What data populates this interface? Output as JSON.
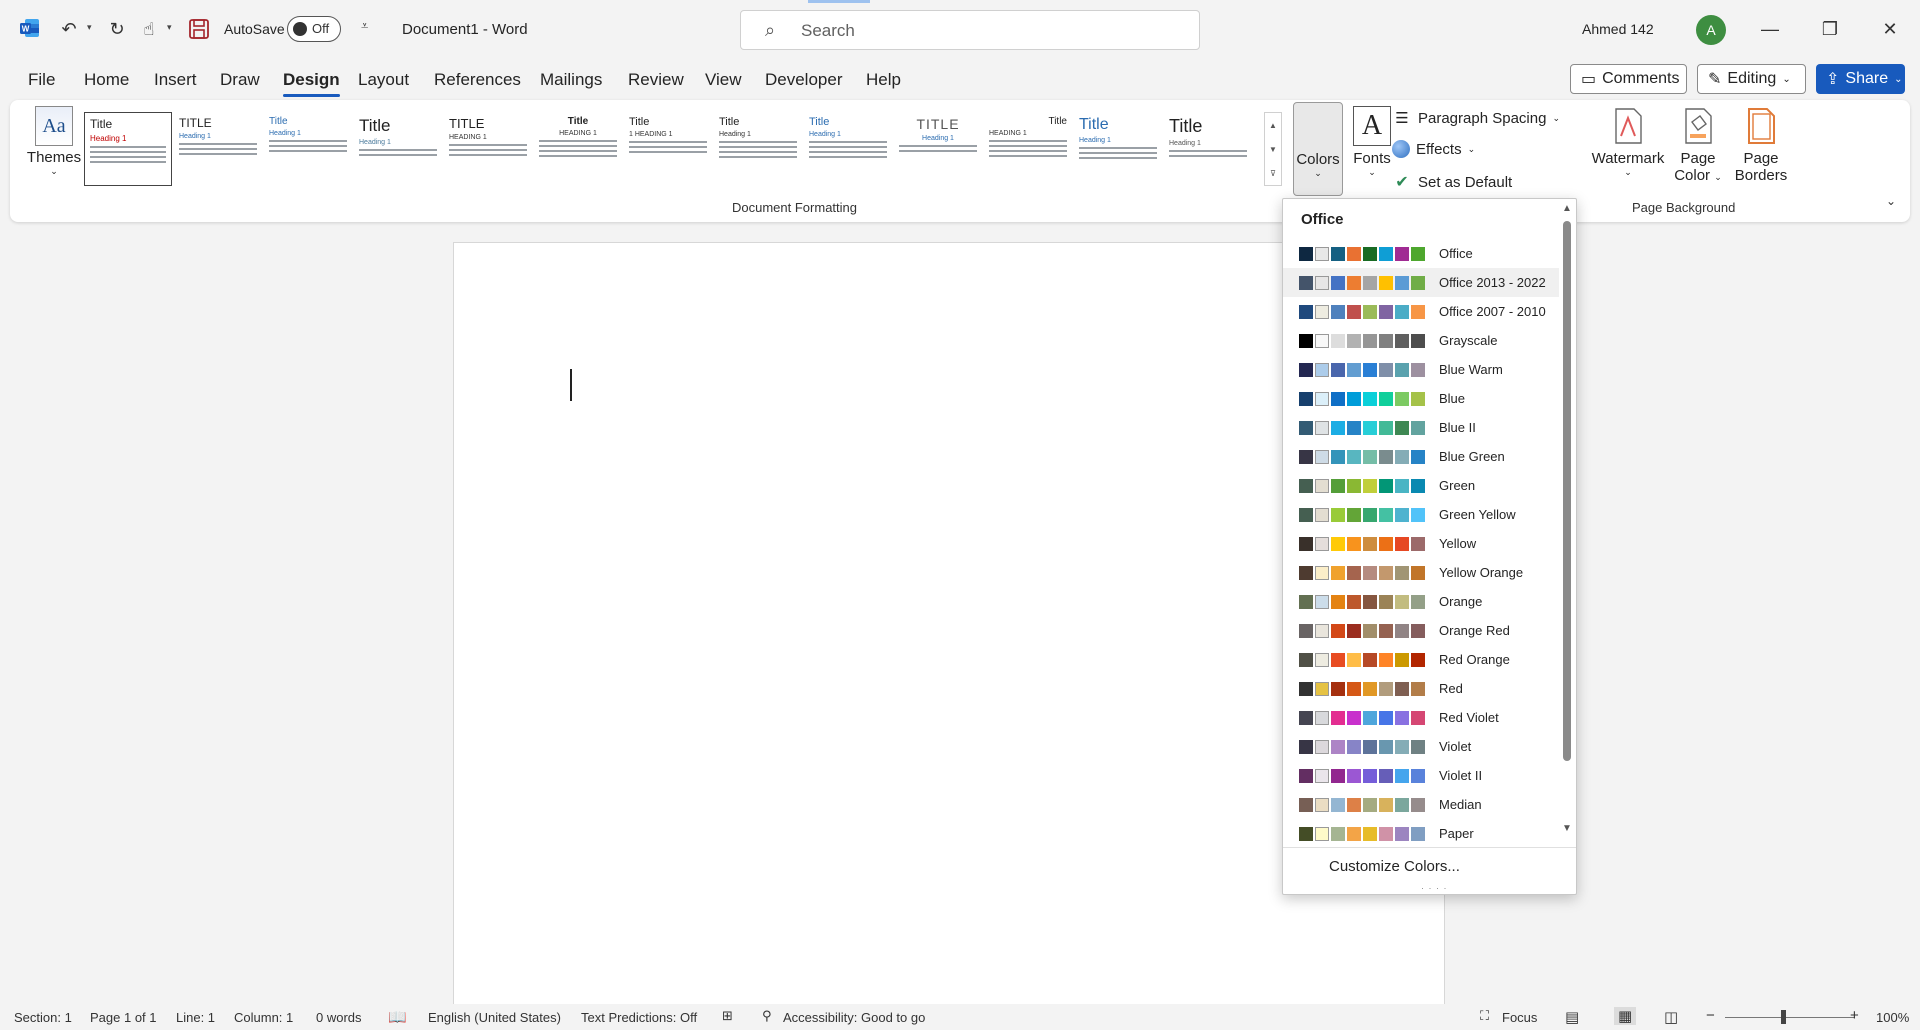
{
  "titlebar": {
    "autosave_label": "AutoSave",
    "autosave_state": "Off",
    "document_title": "Document1  -  Word",
    "search_placeholder": "Search",
    "user_name": "Ahmed 142",
    "avatar_initial": "A"
  },
  "menu": {
    "tabs": [
      "File",
      "Home",
      "Insert",
      "Draw",
      "Design",
      "Layout",
      "References",
      "Mailings",
      "Review",
      "View",
      "Developer",
      "Help"
    ],
    "active_tab": "Design",
    "comments_label": "Comments",
    "editing_label": "Editing",
    "share_label": "Share"
  },
  "ribbon": {
    "themes_label": "Themes",
    "document_formatting_label": "Document Formatting",
    "gallery": [
      {
        "title": "Title",
        "heading": "Heading 1"
      },
      {
        "title": "TITLE",
        "heading": "Heading 1"
      },
      {
        "title": "Title",
        "heading": "Heading 1"
      },
      {
        "title": "Title",
        "heading": "Heading 1"
      },
      {
        "title": "TITLE",
        "heading": "HEADING 1"
      },
      {
        "title": "Title",
        "heading": "HEADING 1"
      },
      {
        "title": "Title",
        "heading": "1  HEADING 1"
      },
      {
        "title": "Title",
        "heading": "Heading 1"
      },
      {
        "title": "Title",
        "heading": "Heading 1"
      },
      {
        "title": "TITLE",
        "heading": "Heading 1"
      },
      {
        "title": "Title",
        "heading": "HEADING 1"
      },
      {
        "title": "Title",
        "heading": "Heading 1"
      },
      {
        "title": "Title",
        "heading": "Heading 1"
      }
    ],
    "colors_label": "Colors",
    "fonts_label": "Fonts",
    "paragraph_spacing_label": "Paragraph Spacing",
    "effects_label": "Effects",
    "set_default_label": "Set as Default",
    "watermark_label": "Watermark",
    "page_color_label_1": "Page",
    "page_color_label_2": "Color",
    "page_borders_label_1": "Page",
    "page_borders_label_2": "Borders",
    "page_background_label": "Page Background"
  },
  "colors_dropdown": {
    "header": "Office",
    "hovered": "Office 2013 - 2022",
    "items": [
      {
        "name": "Office",
        "swatches": [
          "#0e2841",
          "#e8e8e8",
          "#156082",
          "#e97132",
          "#196b24",
          "#0f9ed5",
          "#a02b93",
          "#4ea72e"
        ]
      },
      {
        "name": "Office 2013 - 2022",
        "swatches": [
          "#44546a",
          "#e7e6e6",
          "#4472c4",
          "#ed7d31",
          "#a5a5a5",
          "#ffc000",
          "#5b9bd5",
          "#70ad47"
        ]
      },
      {
        "name": "Office 2007 - 2010",
        "swatches": [
          "#1f497d",
          "#eeece1",
          "#4f81bd",
          "#c0504d",
          "#9bbb59",
          "#8064a2",
          "#4bacc6",
          "#f79646"
        ]
      },
      {
        "name": "Grayscale",
        "swatches": [
          "#000000",
          "#f8f8f8",
          "#dddddd",
          "#b2b2b2",
          "#969696",
          "#808080",
          "#5f5f5f",
          "#4d4d4d"
        ]
      },
      {
        "name": "Blue Warm",
        "swatches": [
          "#242852",
          "#acccea",
          "#4a66ac",
          "#629dd1",
          "#297fd5",
          "#7f8fa9",
          "#5aa2ae",
          "#9d90a0"
        ]
      },
      {
        "name": "Blue",
        "swatches": [
          "#17406d",
          "#dbeff9",
          "#0f6fc6",
          "#009dd9",
          "#0bd0d9",
          "#10cf9b",
          "#7cca62",
          "#a5c249"
        ]
      },
      {
        "name": "Blue II",
        "swatches": [
          "#335b74",
          "#dfe3e5",
          "#1cade4",
          "#2683c6",
          "#27ced7",
          "#42ba97",
          "#3e8853",
          "#62a39f"
        ]
      },
      {
        "name": "Blue Green",
        "swatches": [
          "#373545",
          "#cedbe6",
          "#3494ba",
          "#58b6c0",
          "#75bda7",
          "#7a8c8e",
          "#84acb6",
          "#2683c6"
        ]
      },
      {
        "name": "Green",
        "swatches": [
          "#455f51",
          "#e3ded1",
          "#549e39",
          "#8ab833",
          "#c0cf3a",
          "#029676",
          "#4ab5c4",
          "#0989b1"
        ]
      },
      {
        "name": "Green Yellow",
        "swatches": [
          "#455f51",
          "#e3ded1",
          "#99cb38",
          "#63a537",
          "#37a76f",
          "#44c1a3",
          "#4eb3cf",
          "#51c3f9"
        ]
      },
      {
        "name": "Yellow",
        "swatches": [
          "#39302a",
          "#e5dedb",
          "#ffca08",
          "#f8931d",
          "#ce8d3e",
          "#ec7016",
          "#e64823",
          "#9c6a6a"
        ]
      },
      {
        "name": "Yellow Orange",
        "swatches": [
          "#4e3b30",
          "#fbeec9",
          "#f0a22e",
          "#a5644e",
          "#b58b80",
          "#c3986d",
          "#a19574",
          "#c17529"
        ]
      },
      {
        "name": "Orange",
        "swatches": [
          "#637052",
          "#ccddea",
          "#e48312",
          "#bd582c",
          "#865640",
          "#9b8357",
          "#c2bc80",
          "#94a088"
        ]
      },
      {
        "name": "Orange Red",
        "swatches": [
          "#696464",
          "#e9e5dc",
          "#d34817",
          "#9b2d1f",
          "#a28e6a",
          "#956251",
          "#918485",
          "#855d5d"
        ]
      },
      {
        "name": "Red Orange",
        "swatches": [
          "#505046",
          "#eeece1",
          "#e84c22",
          "#ffbd47",
          "#b64926",
          "#ff8427",
          "#cc9900",
          "#b22600"
        ]
      },
      {
        "name": "Red",
        "swatches": [
          "#323232",
          "#e5c243",
          "#a5300f",
          "#d55816",
          "#e19825",
          "#b19c7d",
          "#7f5f52",
          "#b27d49"
        ]
      },
      {
        "name": "Red Violet",
        "swatches": [
          "#454551",
          "#d8d9dc",
          "#e32d91",
          "#c830cc",
          "#4ea6dc",
          "#4775e7",
          "#8971e1",
          "#d54773"
        ]
      },
      {
        "name": "Violet",
        "swatches": [
          "#373545",
          "#dcd8dc",
          "#ad84c6",
          "#8784c7",
          "#5d739a",
          "#6997af",
          "#84acb6",
          "#6f8183"
        ]
      },
      {
        "name": "Violet II",
        "swatches": [
          "#632e62",
          "#eae5eb",
          "#92278f",
          "#9b57d3",
          "#755dd9",
          "#665eb8",
          "#45a5ed",
          "#5982db"
        ]
      },
      {
        "name": "Median",
        "swatches": [
          "#775f55",
          "#ebddc3",
          "#94b6d2",
          "#dd8047",
          "#a5ab81",
          "#d8b25c",
          "#7ba79d",
          "#968c8c"
        ]
      },
      {
        "name": "Paper",
        "swatches": [
          "#444d26",
          "#fefac9",
          "#a5b592",
          "#f3a447",
          "#e7bc29",
          "#d092a7",
          "#9c85c0",
          "#809ec2"
        ]
      }
    ],
    "customize_label": "Customize Colors..."
  },
  "statusbar": {
    "section": "Section: 1",
    "page": "Page 1 of 1",
    "line": "Line: 1",
    "column": "Column: 1",
    "words": "0 words",
    "language": "English (United States)",
    "text_predictions": "Text Predictions: Off",
    "accessibility": "Accessibility: Good to go",
    "focus": "Focus",
    "zoom": "100%"
  },
  "colors": {
    "accent": "#185abd",
    "avatar": "#3e8e41"
  }
}
